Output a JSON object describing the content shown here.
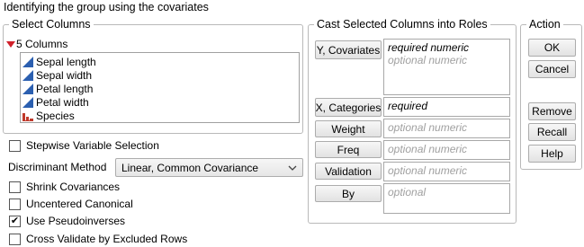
{
  "dialog": {
    "title": "Identifying the group using the covariates"
  },
  "select_columns": {
    "legend": "Select Columns",
    "header": "5 Columns",
    "items": [
      {
        "label": "Sepal length",
        "icon": "continuous-icon"
      },
      {
        "label": "Sepal width",
        "icon": "continuous-icon"
      },
      {
        "label": "Petal length",
        "icon": "continuous-icon"
      },
      {
        "label": "Petal width",
        "icon": "continuous-icon"
      },
      {
        "label": "Species",
        "icon": "nominal-icon"
      }
    ]
  },
  "options": {
    "stepwise": {
      "label": "Stepwise Variable Selection",
      "checked": false
    },
    "method_label": "Discriminant Method",
    "method_value": "Linear, Common Covariance",
    "shrink": {
      "label": "Shrink Covariances",
      "checked": false
    },
    "uncentered": {
      "label": "Uncentered Canonical",
      "checked": false
    },
    "pseudo": {
      "label": "Use Pseudoinverses",
      "checked": true
    },
    "crossval": {
      "label": "Cross Validate by Excluded Rows",
      "checked": false
    }
  },
  "roles": {
    "legend": "Cast Selected Columns into Roles",
    "y_covariates": {
      "button": "Y, Covariates",
      "line1": "required numeric",
      "line2": "optional numeric"
    },
    "x_categories": {
      "button": "X, Categories",
      "hint": "required"
    },
    "weight": {
      "button": "Weight",
      "hint": "optional numeric"
    },
    "freq": {
      "button": "Freq",
      "hint": "optional numeric"
    },
    "validation": {
      "button": "Validation",
      "hint": "optional numeric"
    },
    "by": {
      "button": "By",
      "hint": "optional"
    }
  },
  "action": {
    "legend": "Action",
    "ok": "OK",
    "cancel": "Cancel",
    "remove": "Remove",
    "recall": "Recall",
    "help": "Help"
  },
  "colors": {
    "continuous_icon": "#2b5fb0",
    "nominal_icon": "#c0392b",
    "disclosure": "#d0202a",
    "hint_required": "#000000",
    "hint_optional": "#a0a0a0"
  }
}
